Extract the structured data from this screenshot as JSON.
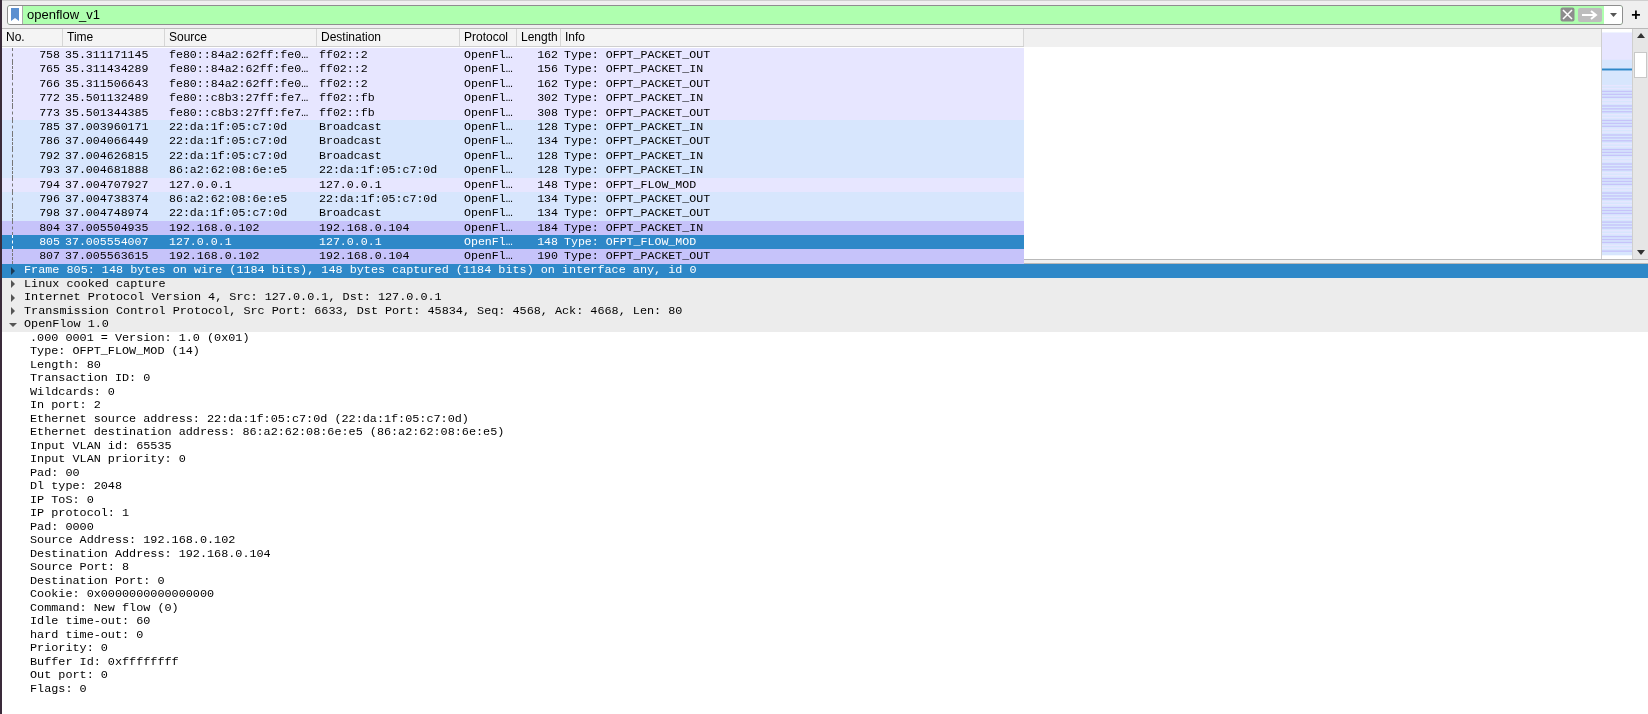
{
  "filter_bar": {
    "value": "openflow_v1",
    "valid": true,
    "add_label": "+"
  },
  "packet_list": {
    "columns": [
      "No.",
      "Time",
      "Source",
      "Destination",
      "Protocol",
      "Length",
      "Info"
    ],
    "rows": [
      {
        "no": "758",
        "time": "35.311171145",
        "source": "fe80::84a2:62ff:fe0…",
        "destination": "ff02::2",
        "protocol": "OpenFl…",
        "length": "162",
        "info": "Type: OFPT_PACKET_OUT",
        "color": "#e7e6ff",
        "selected": false
      },
      {
        "no": "765",
        "time": "35.311434289",
        "source": "fe80::84a2:62ff:fe0…",
        "destination": "ff02::2",
        "protocol": "OpenFl…",
        "length": "156",
        "info": "Type: OFPT_PACKET_IN",
        "color": "#e7e6ff",
        "selected": false
      },
      {
        "no": "766",
        "time": "35.311506643",
        "source": "fe80::84a2:62ff:fe0…",
        "destination": "ff02::2",
        "protocol": "OpenFl…",
        "length": "162",
        "info": "Type: OFPT_PACKET_OUT",
        "color": "#e7e6ff",
        "selected": false
      },
      {
        "no": "772",
        "time": "35.501132489",
        "source": "fe80::c8b3:27ff:fe7…",
        "destination": "ff02::fb",
        "protocol": "OpenFl…",
        "length": "302",
        "info": "Type: OFPT_PACKET_IN",
        "color": "#e7e6ff",
        "selected": false
      },
      {
        "no": "773",
        "time": "35.501344385",
        "source": "fe80::c8b3:27ff:fe7…",
        "destination": "ff02::fb",
        "protocol": "OpenFl…",
        "length": "308",
        "info": "Type: OFPT_PACKET_OUT",
        "color": "#e7e6ff",
        "selected": false
      },
      {
        "no": "785",
        "time": "37.003960171",
        "source": "22:da:1f:05:c7:0d",
        "destination": "Broadcast",
        "protocol": "OpenFl…",
        "length": "128",
        "info": "Type: OFPT_PACKET_IN",
        "color": "#d7e6fd",
        "selected": false
      },
      {
        "no": "786",
        "time": "37.004066449",
        "source": "22:da:1f:05:c7:0d",
        "destination": "Broadcast",
        "protocol": "OpenFl…",
        "length": "134",
        "info": "Type: OFPT_PACKET_OUT",
        "color": "#d7e6fd",
        "selected": false
      },
      {
        "no": "792",
        "time": "37.004626815",
        "source": "22:da:1f:05:c7:0d",
        "destination": "Broadcast",
        "protocol": "OpenFl…",
        "length": "128",
        "info": "Type: OFPT_PACKET_IN",
        "color": "#d7e6fd",
        "selected": false
      },
      {
        "no": "793",
        "time": "37.004681888",
        "source": "86:a2:62:08:6e:e5",
        "destination": "22:da:1f:05:c7:0d",
        "protocol": "OpenFl…",
        "length": "128",
        "info": "Type: OFPT_PACKET_IN",
        "color": "#d7e6fd",
        "selected": false
      },
      {
        "no": "794",
        "time": "37.004707927",
        "source": "127.0.0.1",
        "destination": "127.0.0.1",
        "protocol": "OpenFl…",
        "length": "148",
        "info": "Type: OFPT_FLOW_MOD",
        "color": "#e7e6ff",
        "selected": false
      },
      {
        "no": "796",
        "time": "37.004738374",
        "source": "86:a2:62:08:6e:e5",
        "destination": "22:da:1f:05:c7:0d",
        "protocol": "OpenFl…",
        "length": "134",
        "info": "Type: OFPT_PACKET_OUT",
        "color": "#d7e6fd",
        "selected": false
      },
      {
        "no": "798",
        "time": "37.004748974",
        "source": "22:da:1f:05:c7:0d",
        "destination": "Broadcast",
        "protocol": "OpenFl…",
        "length": "134",
        "info": "Type: OFPT_PACKET_OUT",
        "color": "#d7e6fd",
        "selected": false
      },
      {
        "no": "804",
        "time": "37.005504935",
        "source": "192.168.0.102",
        "destination": "192.168.0.104",
        "protocol": "OpenFl…",
        "length": "184",
        "info": "Type: OFPT_PACKET_IN",
        "color": "#c6c3fa",
        "selected": false
      },
      {
        "no": "805",
        "time": "37.005554007",
        "source": "127.0.0.1",
        "destination": "127.0.0.1",
        "protocol": "OpenFl…",
        "length": "148",
        "info": "Type: OFPT_FLOW_MOD",
        "selected": true
      },
      {
        "no": "807",
        "time": "37.005563615",
        "source": "192.168.0.102",
        "destination": "192.168.0.104",
        "protocol": "OpenFl…",
        "length": "190",
        "info": "Type: OFPT_PACKET_OUT",
        "color": "#c6c3fa",
        "selected": false
      }
    ]
  },
  "packet_details": [
    {
      "text": "Frame 805: 148 bytes on wire (1184 bits), 148 bytes captured (1184 bits) on interface any, id 0",
      "expanded": false,
      "selected": true
    },
    {
      "text": "Linux cooked capture",
      "expanded": false,
      "selected": false
    },
    {
      "text": "Internet Protocol Version 4, Src: 127.0.0.1, Dst: 127.0.0.1",
      "expanded": false,
      "selected": false
    },
    {
      "text": "Transmission Control Protocol, Src Port: 6633, Dst Port: 45834, Seq: 4568, Ack: 4668, Len: 80",
      "expanded": false,
      "selected": false
    },
    {
      "text": "OpenFlow 1.0",
      "expanded": true,
      "selected": false,
      "children": [
        {
          "text": ".000 0001 = Version: 1.0 (0x01)"
        },
        {
          "text": "Type: OFPT_FLOW_MOD (14)"
        },
        {
          "text": "Length: 80"
        },
        {
          "text": "Transaction ID: 0"
        },
        {
          "text": "Wildcards: 0"
        },
        {
          "text": "In port: 2"
        },
        {
          "text": "Ethernet source address: 22:da:1f:05:c7:0d (22:da:1f:05:c7:0d)"
        },
        {
          "text": "Ethernet destination address: 86:a2:62:08:6e:e5 (86:a2:62:08:6e:e5)"
        },
        {
          "text": "Input VLAN id: 65535"
        },
        {
          "text": "Input VLAN priority: 0"
        },
        {
          "text": "Pad: 00"
        },
        {
          "text": "Dl type: 2048"
        },
        {
          "text": "IP ToS: 0"
        },
        {
          "text": "IP protocol: 1"
        },
        {
          "text": "Pad: 0000"
        },
        {
          "text": "Source Address: 192.168.0.102"
        },
        {
          "text": "Destination Address: 192.168.0.104"
        },
        {
          "text": "Source Port: 8"
        },
        {
          "text": "Destination Port: 0"
        },
        {
          "text": "Cookie: 0x0000000000000000"
        },
        {
          "text": "Command: New flow (0)"
        },
        {
          "text": "Idle time-out: 60"
        },
        {
          "text": "hard time-out: 0"
        },
        {
          "text": "Priority: 0"
        },
        {
          "text": "Buffer Id: 0xffffffff"
        },
        {
          "text": "Out port: 0"
        },
        {
          "text": "Flags: 0"
        }
      ]
    }
  ]
}
